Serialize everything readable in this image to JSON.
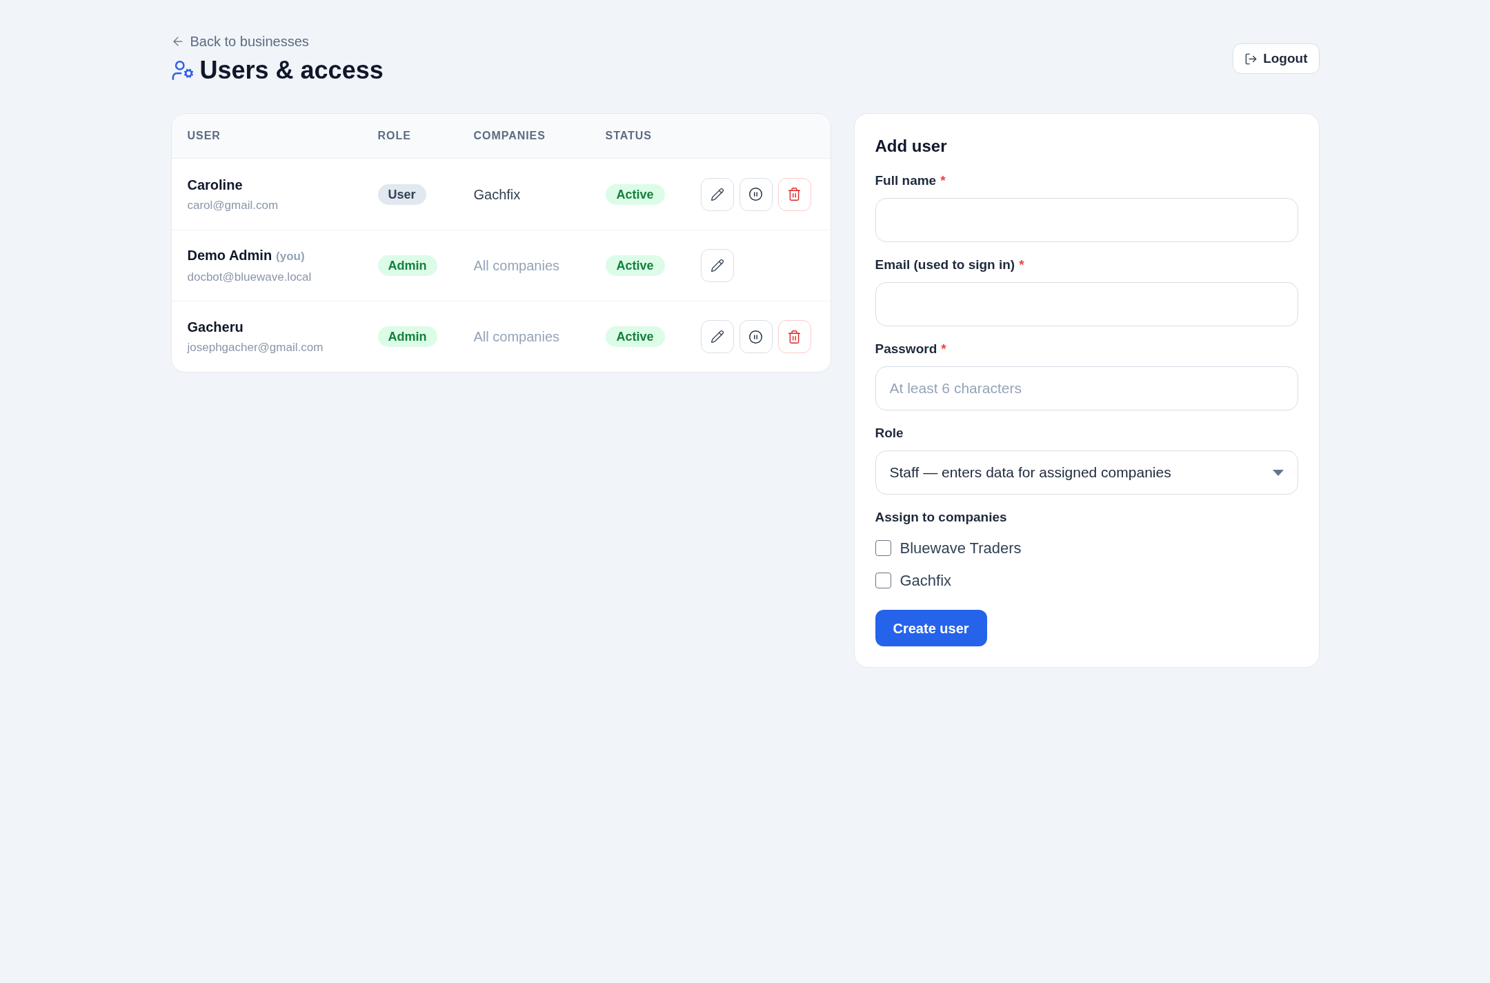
{
  "header": {
    "back_link": "Back to businesses",
    "title": "Users & access",
    "logout_button": "Logout"
  },
  "users_table": {
    "columns": [
      "USER",
      "ROLE",
      "COMPANIES",
      "STATUS"
    ],
    "rows": [
      {
        "name": "Caroline",
        "email": "carol@gmail.com",
        "role": {
          "label": "User",
          "kind": "user"
        },
        "companies": {
          "text": "Gachfix",
          "kind": "assigned"
        },
        "status": {
          "label": "Active",
          "kind": "active"
        },
        "actions": [
          {
            "kind": "edit"
          },
          {
            "kind": "pause"
          },
          {
            "kind": "delete"
          }
        ]
      },
      {
        "name": "Demo Admin",
        "you_tag": "(you)",
        "email": "docbot@bluewave.local",
        "role": {
          "label": "Admin",
          "kind": "admin"
        },
        "companies": {
          "text": "All companies",
          "kind": "all"
        },
        "status": {
          "label": "Active",
          "kind": "active"
        },
        "actions": [
          {
            "kind": "edit"
          }
        ]
      },
      {
        "name": "Gacheru",
        "email": "josephgacher@gmail.com",
        "role": {
          "label": "Admin",
          "kind": "admin"
        },
        "companies": {
          "text": "All companies",
          "kind": "all"
        },
        "status": {
          "label": "Active",
          "kind": "active"
        },
        "actions": [
          {
            "kind": "edit"
          },
          {
            "kind": "pause"
          },
          {
            "kind": "delete"
          }
        ]
      }
    ]
  },
  "add_user_form": {
    "title": "Add user",
    "fields": [
      {
        "kind": "text",
        "label": "Full name",
        "required_mark": "*"
      },
      {
        "kind": "email",
        "label": "Email (used to sign in)",
        "required_mark": "*"
      },
      {
        "kind": "password",
        "label": "Password",
        "required_mark": "*",
        "placeholder": "At least 6 characters"
      },
      {
        "kind": "select",
        "label": "Role",
        "value": "Staff — enters data for assigned companies"
      }
    ],
    "companies_label": "Assign to companies",
    "companies": [
      {
        "label": "Bluewave Traders",
        "checked": false
      },
      {
        "label": "Gachfix",
        "checked": false
      }
    ],
    "submit_button": "Create user"
  }
}
